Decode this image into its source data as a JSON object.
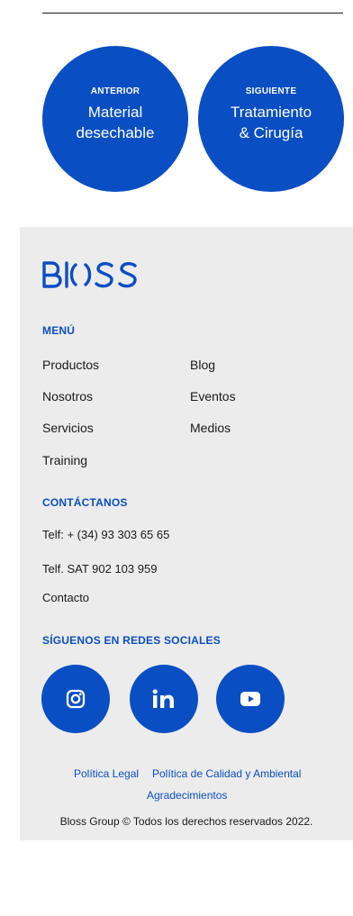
{
  "post_nav": {
    "previous": {
      "kicker": "ANTERIOR",
      "title_line1": "Material",
      "title_line2": "desechable"
    },
    "next": {
      "kicker": "SIGUIENTE",
      "title_line1": "Tratamiento",
      "title_line2": "& Cirugía"
    }
  },
  "footer": {
    "logo_text": "BLOSS",
    "menu": {
      "title": "MENÚ",
      "left_items": [
        "Productos",
        "Nosotros",
        "Servicios",
        "Training"
      ],
      "right_items": [
        "Blog",
        "Eventos",
        "Medios"
      ]
    },
    "contact": {
      "title": "CONTÁCTANOS",
      "phone": "Telf: + (34) 93 303 65 65",
      "sat_phone": "Telf. SAT 902 103 959",
      "contact_link": "Contacto"
    },
    "social": {
      "title": "SÍGUENOS EN REDES SOCIALES",
      "icons": [
        "instagram-icon",
        "linkedin-icon",
        "youtube-icon"
      ]
    },
    "legal": {
      "policy_legal": "Política Legal",
      "policy_quality": "Política de Calidad y Ambiental",
      "thanks": "Agradecimientos"
    },
    "copyright": "Bloss Group © Todos los derechos reservados 2022."
  },
  "colors": {
    "brand_blue": "#0a4ec4",
    "footer_bg": "#ececec"
  }
}
